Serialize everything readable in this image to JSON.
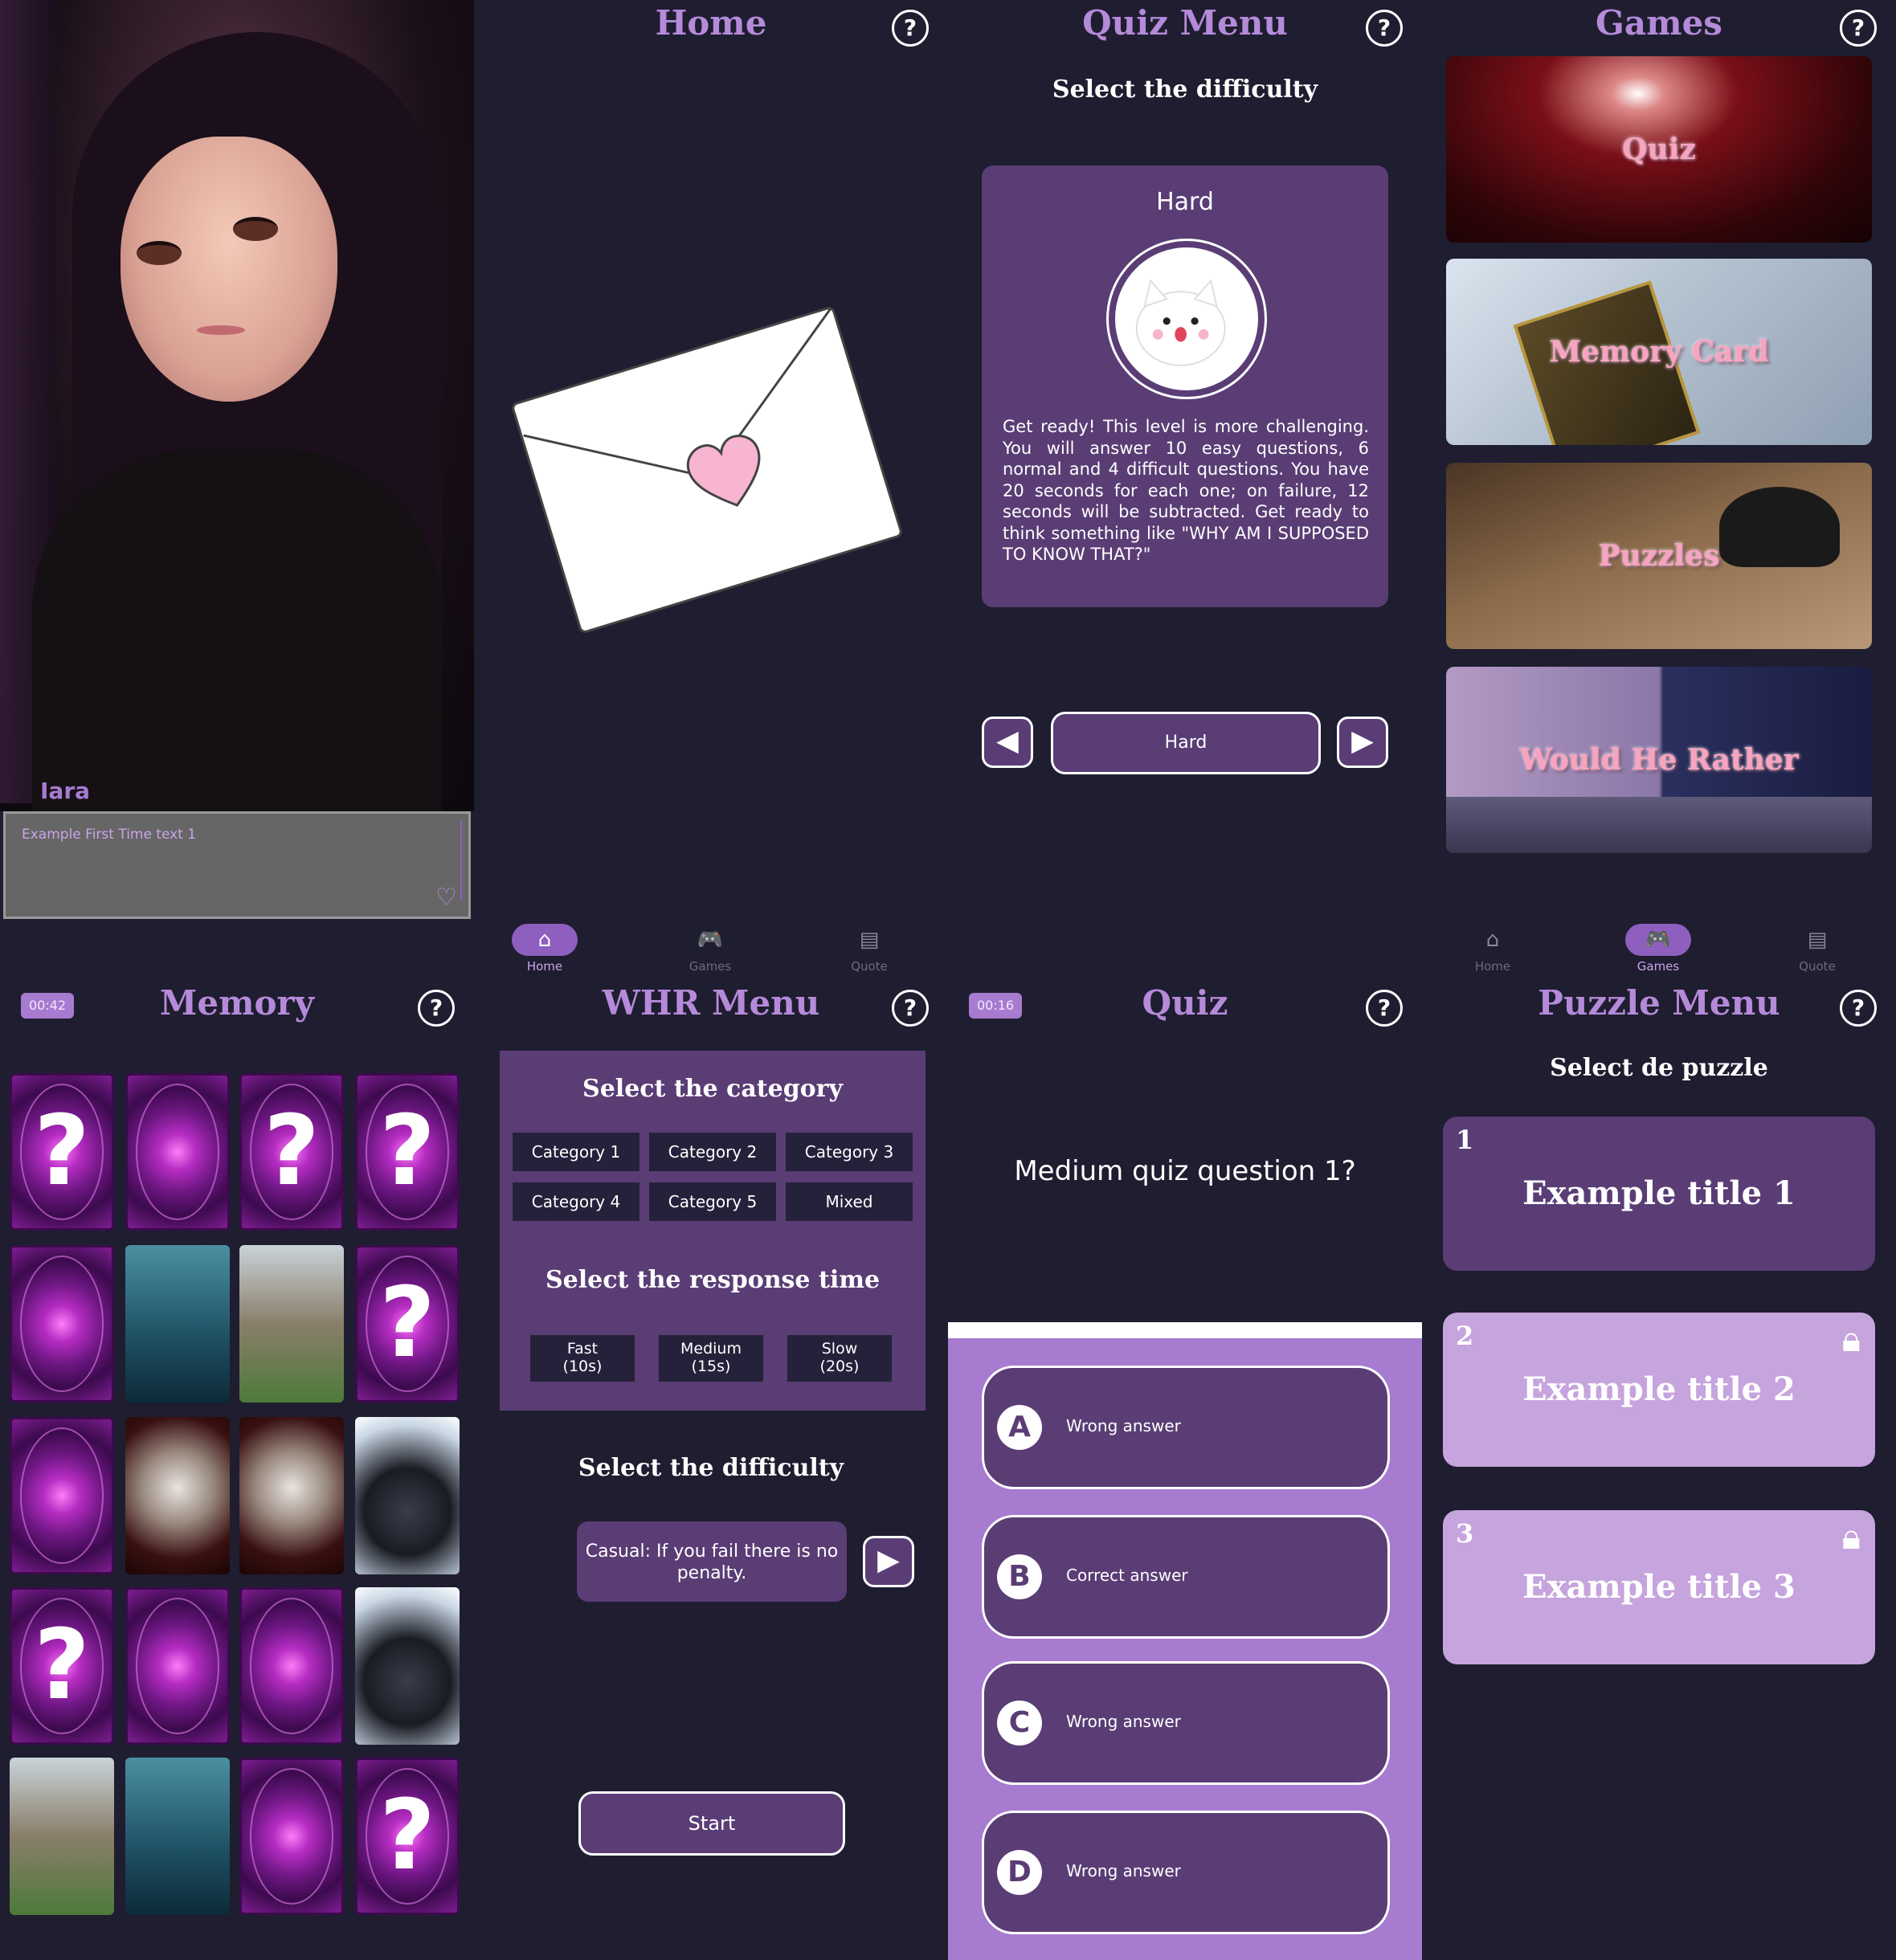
{
  "colors": {
    "background": "#1f1d30",
    "accent": "#a77bd0",
    "card": "#5a3d75",
    "light_card": "#c6a4dd",
    "title": "#b48ad9"
  },
  "character_panel": {
    "character_name": "Iara",
    "dialog_text": "Example First Time text 1",
    "heart_icon": "heart-outline-icon"
  },
  "home_panel": {
    "title": "Home",
    "help_label": "?",
    "illustration": "love-letter-envelope",
    "nav": [
      {
        "label": "Home",
        "icon": "home-icon",
        "active": true
      },
      {
        "label": "Games",
        "icon": "gamepad-icon",
        "active": false
      },
      {
        "label": "Quote",
        "icon": "book-icon",
        "active": false
      }
    ]
  },
  "quiz_menu_panel": {
    "title": "Quiz Menu",
    "help_label": "?",
    "subtitle": "Select the difficulty",
    "card_title": "Hard",
    "description": "Get ready! This level is more challenging. You will answer 10 easy questions, 6 normal and 4 difficult questions. You have 20 seconds for each one; on failure, 12 seconds will be subtracted. Get ready to think something like \"WHY AM I SUPPOSED TO KNOW THAT?\"",
    "selected_difficulty": "Hard",
    "prev_icon": "triangle-left-icon",
    "next_icon": "triangle-right-icon"
  },
  "games_panel": {
    "title": "Games",
    "help_label": "?",
    "games": [
      {
        "label": "Quiz"
      },
      {
        "label": "Memory Card"
      },
      {
        "label": "Puzzles"
      },
      {
        "label": "Would He Rather"
      }
    ],
    "nav": [
      {
        "label": "Home",
        "icon": "home-icon",
        "active": false
      },
      {
        "label": "Games",
        "icon": "gamepad-icon",
        "active": true
      },
      {
        "label": "Quote",
        "icon": "book-icon",
        "active": false
      }
    ]
  },
  "memory_panel": {
    "title": "Memory",
    "help_label": "?",
    "timer": "00:42",
    "question_mark": "?"
  },
  "whr_menu_panel": {
    "title": "WHR Menu",
    "help_label": "?",
    "category_heading": "Select the category",
    "categories": [
      "Category 1",
      "Category 2",
      "Category 3",
      "Category 4",
      "Category 5",
      "Mixed"
    ],
    "response_heading": "Select the response time",
    "response_times": [
      {
        "label": "Fast",
        "value": "(10s)"
      },
      {
        "label": "Medium",
        "value": "(15s)"
      },
      {
        "label": "Slow",
        "value": "(20s)"
      }
    ],
    "difficulty_heading": "Select the difficulty",
    "difficulty_text": "Casual: If you fail there is no penalty.",
    "start_label": "Start"
  },
  "quiz_panel": {
    "title": "Quiz",
    "help_label": "?",
    "timer": "00:16",
    "question": "Medium quiz question 1?",
    "answers": [
      {
        "letter": "A",
        "text": "Wrong answer"
      },
      {
        "letter": "B",
        "text": "Correct answer"
      },
      {
        "letter": "C",
        "text": "Wrong answer"
      },
      {
        "letter": "D",
        "text": "Wrong answer"
      }
    ]
  },
  "puzzle_menu_panel": {
    "title": "Puzzle Menu",
    "help_label": "?",
    "subtitle": "Select de puzzle",
    "puzzles": [
      {
        "number": "1",
        "title": "Example title 1",
        "locked": false
      },
      {
        "number": "2",
        "title": "Example title 2",
        "locked": true
      },
      {
        "number": "3",
        "title": "Example title 3",
        "locked": true
      }
    ]
  }
}
